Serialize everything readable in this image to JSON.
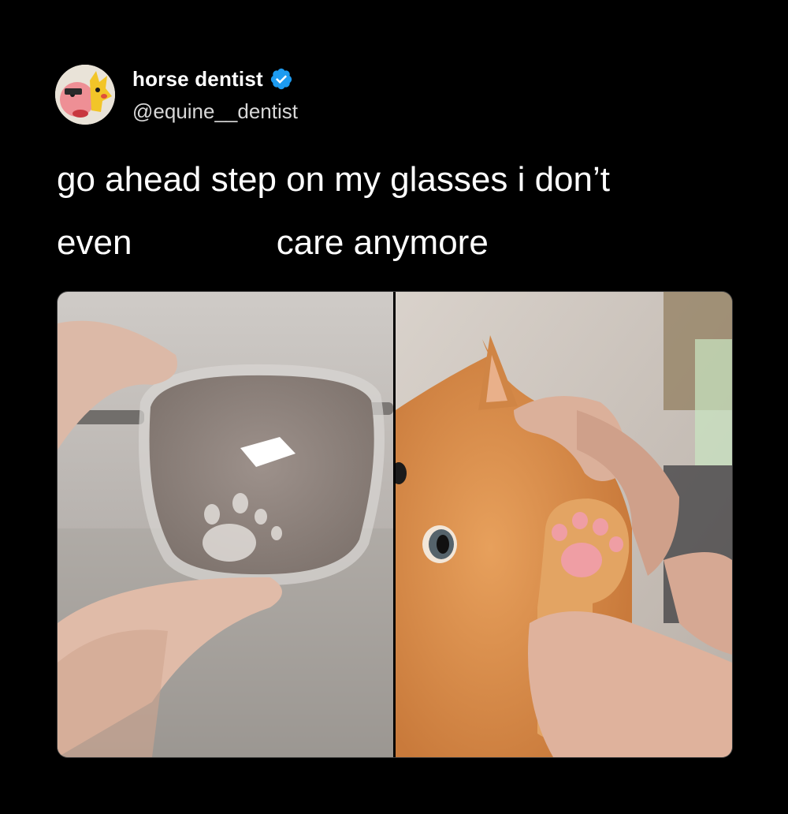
{
  "tweet": {
    "author": {
      "display_name": "horse dentist",
      "handle": "@equine__dentist",
      "verified": true,
      "verified_icon": "verified-badge-icon",
      "verified_color": "#1d9bf0"
    },
    "text_lines": [
      "go ahead step on my glasses i don’t",
      "even               care anymore"
    ],
    "media": [
      {
        "kind": "photo",
        "description_name": "smudged-glasses-photo"
      },
      {
        "kind": "photo",
        "description_name": "kitten-paw-photo"
      }
    ]
  },
  "colors": {
    "background": "#000000",
    "text": "#ffffff",
    "handle_text": "#d8d8d8",
    "verified_blue": "#1d9bf0"
  }
}
